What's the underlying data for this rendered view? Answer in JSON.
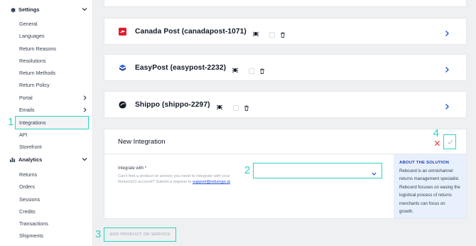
{
  "sidebar": {
    "settings": {
      "title": "Settings",
      "items": [
        {
          "label": "General"
        },
        {
          "label": "Languages"
        },
        {
          "label": "Return Reasons"
        },
        {
          "label": "Resolutions"
        },
        {
          "label": "Return Methods"
        },
        {
          "label": "Return Policy"
        },
        {
          "label": "Portal"
        },
        {
          "label": "Emails"
        },
        {
          "label": "Integrations"
        },
        {
          "label": "API"
        },
        {
          "label": "Storefront"
        }
      ]
    },
    "analytics": {
      "title": "Analytics",
      "items": [
        {
          "label": "Returns"
        },
        {
          "label": "Orders"
        },
        {
          "label": "Sessions"
        },
        {
          "label": "Credits"
        },
        {
          "label": "Transactions"
        },
        {
          "label": "Shipments"
        }
      ]
    }
  },
  "integrations": [
    {
      "name": "Canada Post (canadapost-1071)",
      "logo": "canada-post-logo"
    },
    {
      "name": "EasyPost (easypost-2232)",
      "logo": "easypost-logo"
    },
    {
      "name": "Shippo (shippo-2297)",
      "logo": "shippo-logo"
    }
  ],
  "new_integration": {
    "title": "New Integration",
    "label": "Integrate with *",
    "help_text": "Can't find a product or service you need to integrate with your ReturnGO account? Submit a request to ",
    "help_link": "support@returngo.ai",
    "about_title": "ABOUT THE SOLUTION",
    "about_body": "Rebound is an omnichannel returns management specialist. Rebound focuses on easing the logistical process of returns merchants can focus on growth."
  },
  "add_button": "ADD PRODUCT OR SERVICE",
  "markers": [
    "1",
    "2",
    "3",
    "4"
  ],
  "colors": {
    "accent": "#2dd4bf",
    "link": "#1d4ed8",
    "cancel": "#ef4444",
    "about_bg": "#e8f0fe"
  }
}
